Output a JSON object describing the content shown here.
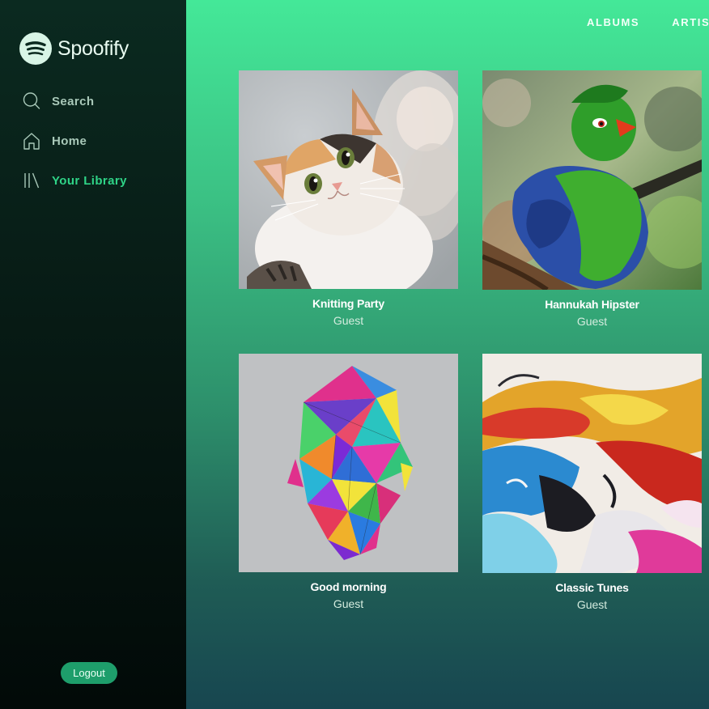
{
  "app": {
    "name": "Spoofify"
  },
  "sidebar": {
    "items": [
      {
        "label": "Search",
        "icon": "search-icon"
      },
      {
        "label": "Home",
        "icon": "home-icon"
      },
      {
        "label": "Your Library",
        "icon": "library-icon",
        "active": true
      }
    ],
    "logout_label": "Logout"
  },
  "topnav": {
    "links": [
      "ALBUMS",
      "ARTISTS"
    ]
  },
  "playlists": [
    {
      "title": "Knitting Party",
      "owner": "Guest",
      "art": "kitten-photo"
    },
    {
      "title": "Hannukah Hipster",
      "owner": "Guest",
      "art": "green-bird-photo"
    },
    {
      "title": "Good morning",
      "owner": "Guest",
      "art": "polygon-head-art"
    },
    {
      "title": "Classic Tunes",
      "owner": "Guest",
      "art": "fluid-paint-art"
    }
  ],
  "colors": {
    "accent": "#2fd487",
    "logout_bg": "#1e9e6b",
    "sidebar_bg": "#061712",
    "main_top": "#44e898",
    "main_bottom": "#174650"
  }
}
